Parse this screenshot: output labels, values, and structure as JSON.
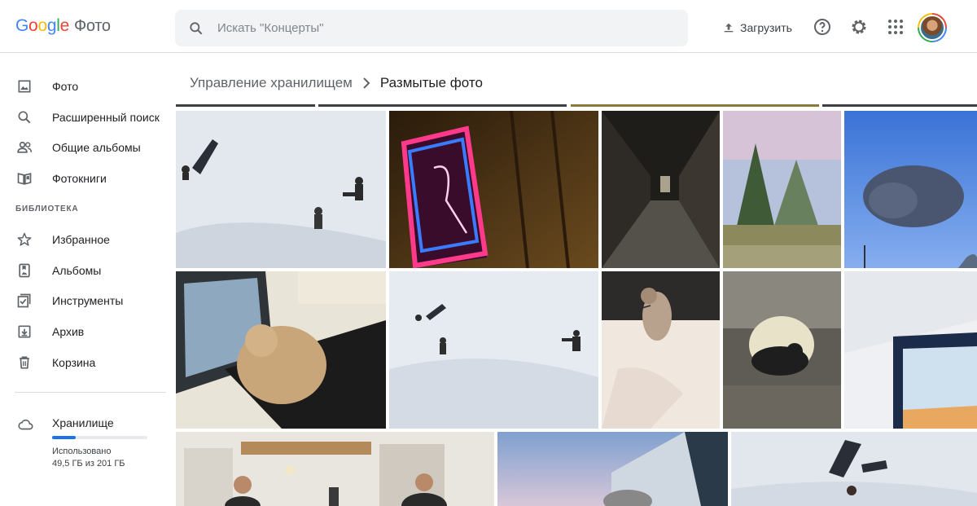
{
  "app": {
    "logo": {
      "g1": "G",
      "o1": "o",
      "o2": "o",
      "g2": "g",
      "l": "l",
      "e": "e",
      "product": "Фото"
    }
  },
  "header": {
    "search_placeholder": "Искать \"Концерты\"",
    "upload_label": "Загрузить",
    "icons": [
      "upload-icon",
      "help-icon",
      "gear-icon",
      "apps-icon"
    ]
  },
  "sidebar": {
    "items": [
      {
        "label": "Фото",
        "icon": "photo-icon"
      },
      {
        "label": "Расширенный поиск",
        "icon": "search-icon"
      },
      {
        "label": "Общие альбомы",
        "icon": "people-icon"
      },
      {
        "label": "Фотокниги",
        "icon": "book-icon"
      }
    ],
    "library_label": "БИБЛИОТЕКА",
    "library_items": [
      {
        "label": "Избранное",
        "icon": "star-icon"
      },
      {
        "label": "Альбомы",
        "icon": "album-icon"
      },
      {
        "label": "Инструменты",
        "icon": "tools-icon"
      },
      {
        "label": "Архив",
        "icon": "archive-icon"
      },
      {
        "label": "Корзина",
        "icon": "trash-icon"
      }
    ],
    "storage": {
      "label": "Хранилище",
      "used_label": "Использовано",
      "amount": "49,5 ГБ из 201 ГБ",
      "used_fraction": 0.246
    }
  },
  "main": {
    "breadcrumb": {
      "parent": "Управление хранилищем",
      "current": "Размытые фото"
    },
    "photos": [
      {
        "subject": "snow-lego-figures"
      },
      {
        "subject": "neon-sign"
      },
      {
        "subject": "dark-corridor"
      },
      {
        "subject": "blurry-trees"
      },
      {
        "subject": "cloud-sky"
      },
      {
        "subject": "cat-on-desk"
      },
      {
        "subject": "snow-lego-wide"
      },
      {
        "subject": "cat-on-leash"
      },
      {
        "subject": "cat-in-corridor"
      },
      {
        "subject": "window-ceiling"
      },
      {
        "subject": "people-in-room"
      },
      {
        "subject": "building-glass"
      },
      {
        "subject": "snow-lego-close"
      }
    ]
  },
  "colors": {
    "accent": "#1a73e8",
    "text": "#202124",
    "muted": "#5f6368"
  }
}
